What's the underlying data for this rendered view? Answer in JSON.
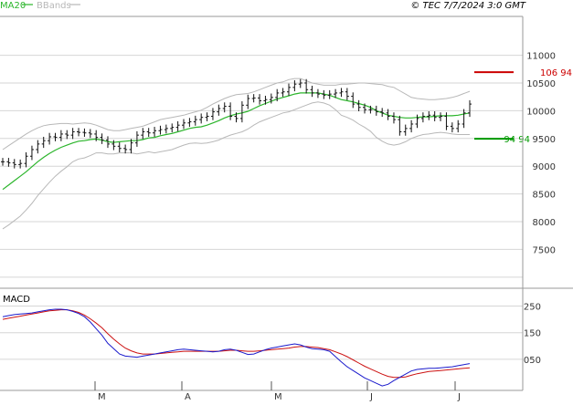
{
  "header": {
    "legend": [
      {
        "label": "MA20",
        "color": "#2bb52b"
      },
      {
        "label": "BBands",
        "color": "#b8b8b8"
      }
    ],
    "copyright": "© TEC 7/7/2024 3:0 GMT"
  },
  "price_panel": {
    "y_ticks": [
      "11000",
      "10500",
      "10000",
      "9500",
      "9000",
      "8500",
      "8000",
      "7500"
    ],
    "resistance": {
      "label": "106 94",
      "value": 10694,
      "color": "#cc0000"
    },
    "support": {
      "label": "94 94",
      "value": 9494,
      "color": "#009900"
    }
  },
  "macd_panel": {
    "label": "MACD",
    "y_ticks": [
      "250",
      "150",
      "050"
    ]
  },
  "x_ticks": [
    "M",
    "A",
    "M",
    "J",
    "J"
  ],
  "colors": {
    "ma20": "#2bb52b",
    "bbands": "#b8b8b8",
    "bars": "#111111",
    "macd": "#1a1acc",
    "signal": "#cc1111",
    "grid": "#d6d6d6",
    "axis": "#999999"
  },
  "chart_data": [
    {
      "type": "ohlc",
      "ylim": [
        6800,
        11700
      ],
      "y_axis_ticks": [
        11000,
        10500,
        10000,
        9500,
        9000,
        8500,
        8000,
        7500
      ],
      "x_axis_ticks": [
        "M",
        "A",
        "M",
        "J",
        "J"
      ],
      "close": [
        9080,
        9060,
        9030,
        9050,
        9180,
        9300,
        9400,
        9460,
        9530,
        9520,
        9580,
        9560,
        9620,
        9610,
        9600,
        9580,
        9520,
        9470,
        9400,
        9360,
        9320,
        9300,
        9420,
        9560,
        9620,
        9600,
        9640,
        9660,
        9680,
        9700,
        9740,
        9780,
        9800,
        9840,
        9880,
        9900,
        9980,
        10040,
        10080,
        9900,
        9860,
        10100,
        10220,
        10230,
        10180,
        10200,
        10240,
        10320,
        10340,
        10420,
        10480,
        10500,
        10380,
        10320,
        10300,
        10280,
        10300,
        10320,
        10340,
        10260,
        10120,
        10060,
        10020,
        10020,
        9980,
        9960,
        9900,
        9840,
        9620,
        9680,
        9760,
        9860,
        9900,
        9920,
        9880,
        9900,
        9720,
        9680,
        9760,
        9960,
        10120
      ],
      "ma20": [
        8580,
        8660,
        8740,
        8820,
        8900,
        8990,
        9080,
        9160,
        9230,
        9290,
        9340,
        9380,
        9420,
        9450,
        9460,
        9480,
        9490,
        9470,
        9440,
        9430,
        9440,
        9450,
        9460,
        9460,
        9480,
        9510,
        9520,
        9550,
        9570,
        9590,
        9620,
        9650,
        9680,
        9700,
        9710,
        9740,
        9780,
        9820,
        9870,
        9910,
        9940,
        9960,
        9990,
        10040,
        10090,
        10130,
        10170,
        10210,
        10240,
        10270,
        10300,
        10320,
        10320,
        10320,
        10320,
        10300,
        10280,
        10240,
        10200,
        10180,
        10160,
        10130,
        10100,
        10060,
        10000,
        9960,
        9920,
        9900,
        9880,
        9870,
        9870,
        9880,
        9890,
        9890,
        9900,
        9910,
        9910,
        9910,
        9920,
        9940,
        9960
      ],
      "bb_upper": [
        9300,
        9370,
        9440,
        9510,
        9580,
        9640,
        9690,
        9730,
        9750,
        9760,
        9770,
        9770,
        9760,
        9770,
        9780,
        9770,
        9740,
        9700,
        9660,
        9640,
        9640,
        9660,
        9680,
        9700,
        9720,
        9760,
        9800,
        9840,
        9860,
        9880,
        9900,
        9920,
        9950,
        9980,
        10010,
        10060,
        10120,
        10170,
        10220,
        10260,
        10290,
        10300,
        10310,
        10340,
        10380,
        10420,
        10460,
        10500,
        10520,
        10560,
        10580,
        10580,
        10540,
        10500,
        10480,
        10460,
        10460,
        10460,
        10480,
        10480,
        10490,
        10500,
        10500,
        10490,
        10480,
        10470,
        10440,
        10420,
        10360,
        10300,
        10240,
        10220,
        10210,
        10200,
        10200,
        10210,
        10220,
        10240,
        10270,
        10310,
        10350
      ],
      "bb_lower": [
        7870,
        7940,
        8020,
        8100,
        8210,
        8330,
        8470,
        8590,
        8710,
        8820,
        8910,
        8990,
        9080,
        9130,
        9150,
        9190,
        9240,
        9240,
        9220,
        9220,
        9240,
        9240,
        9240,
        9220,
        9240,
        9260,
        9240,
        9260,
        9280,
        9300,
        9340,
        9380,
        9410,
        9420,
        9410,
        9420,
        9440,
        9470,
        9520,
        9560,
        9590,
        9620,
        9670,
        9740,
        9800,
        9840,
        9880,
        9920,
        9960,
        9980,
        10020,
        10060,
        10100,
        10140,
        10160,
        10140,
        10100,
        10020,
        9920,
        9880,
        9830,
        9760,
        9700,
        9630,
        9520,
        9450,
        9400,
        9380,
        9400,
        9440,
        9500,
        9540,
        9570,
        9580,
        9600,
        9610,
        9600,
        9580,
        9570,
        9570,
        9570
      ]
    },
    {
      "type": "line",
      "title": "MACD",
      "ylim": [
        -60,
        310
      ],
      "y_axis_ticks": [
        250,
        150,
        50
      ],
      "series": [
        {
          "values": [
            210,
            214,
            218,
            220,
            222,
            224,
            228,
            232,
            236,
            238,
            238,
            236,
            230,
            222,
            210,
            190,
            165,
            140,
            110,
            90,
            70,
            62,
            60,
            58,
            62,
            66,
            70,
            74,
            78,
            82,
            86,
            88,
            86,
            84,
            82,
            80,
            78,
            80,
            86,
            88,
            84,
            76,
            68,
            70,
            78,
            86,
            92,
            96,
            100,
            104,
            108,
            104,
            96,
            90,
            88,
            86,
            80,
            60,
            40,
            22,
            8,
            -6,
            -20,
            -30,
            -40,
            -50,
            -44,
            -30,
            -18,
            -6,
            6,
            12,
            14,
            16,
            16,
            18,
            20,
            22,
            26,
            30,
            34
          ]
        },
        {
          "values": [
            200,
            204,
            208,
            212,
            216,
            220,
            224,
            228,
            232,
            234,
            236,
            236,
            232,
            226,
            216,
            202,
            186,
            168,
            146,
            126,
            108,
            92,
            82,
            74,
            70,
            70,
            70,
            72,
            74,
            76,
            78,
            80,
            80,
            80,
            80,
            80,
            80,
            80,
            82,
            84,
            84,
            82,
            80,
            80,
            82,
            84,
            86,
            88,
            90,
            92,
            96,
            98,
            98,
            96,
            94,
            90,
            86,
            78,
            70,
            60,
            48,
            36,
            24,
            14,
            4,
            -6,
            -14,
            -18,
            -18,
            -16,
            -10,
            -4,
            0,
            4,
            6,
            8,
            10,
            12,
            14,
            16,
            18
          ]
        }
      ]
    }
  ]
}
